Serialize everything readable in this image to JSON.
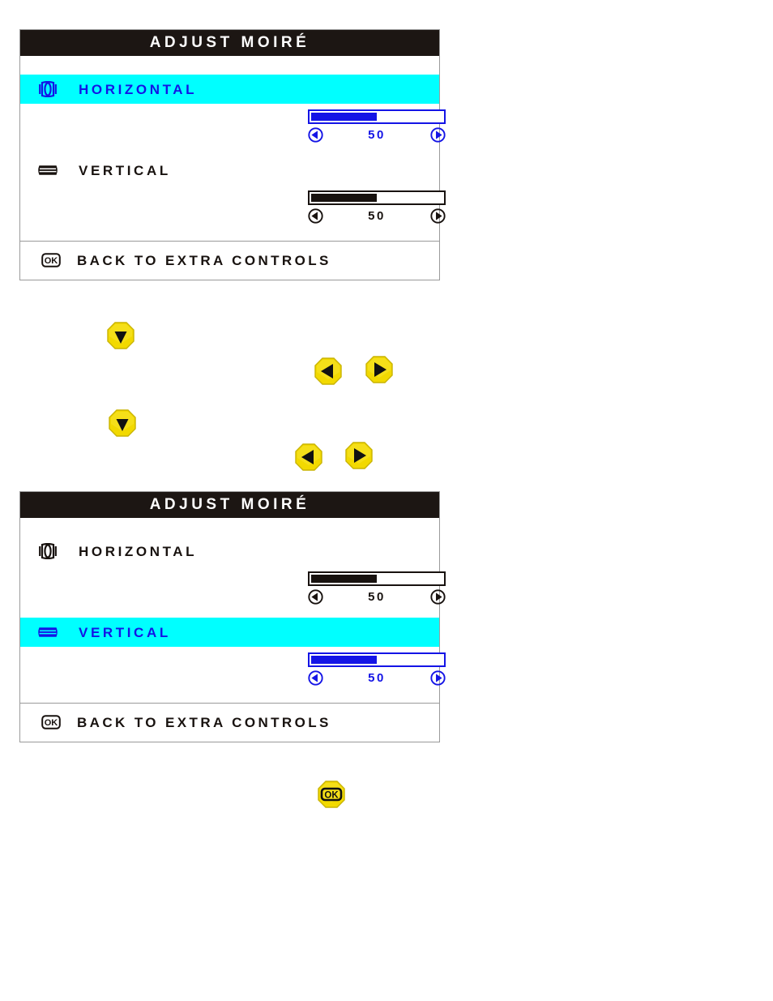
{
  "panels": [
    {
      "title": "ADJUST MOIRÉ",
      "items": [
        {
          "label": "HORIZONTAL",
          "icon": "moire-horizontal-icon",
          "active": true,
          "value": "50",
          "fill_percent": 50,
          "left_arrow": "decrease-arrow-icon",
          "right_arrow": "increase-arrow-icon"
        },
        {
          "label": "VERTICAL",
          "icon": "moire-vertical-icon",
          "active": false,
          "value": "50",
          "fill_percent": 50,
          "left_arrow": "decrease-arrow-icon",
          "right_arrow": "increase-arrow-icon"
        }
      ],
      "back": {
        "label": "BACK TO EXTRA CONTROLS",
        "icon": "ok-button-icon"
      }
    },
    {
      "title": "ADJUST MOIRÉ",
      "items": [
        {
          "label": "HORIZONTAL",
          "icon": "moire-horizontal-icon",
          "active": false,
          "value": "50",
          "fill_percent": 50,
          "left_arrow": "decrease-arrow-icon",
          "right_arrow": "increase-arrow-icon"
        },
        {
          "label": "VERTICAL",
          "icon": "moire-vertical-icon",
          "active": true,
          "value": "50",
          "fill_percent": 50,
          "left_arrow": "decrease-arrow-icon",
          "right_arrow": "increase-arrow-icon"
        }
      ],
      "back": {
        "label": "BACK TO EXTRA CONTROLS",
        "icon": "ok-button-icon"
      }
    }
  ],
  "hardware_buttons": [
    {
      "id": "btn-down-1",
      "name": "down-hardware-button",
      "glyph": "down-triangle-icon"
    },
    {
      "id": "btn-left-1",
      "name": "left-hardware-button",
      "glyph": "left-triangle-icon"
    },
    {
      "id": "btn-right-1",
      "name": "right-hardware-button",
      "glyph": "right-triangle-icon"
    },
    {
      "id": "btn-down-2",
      "name": "down-hardware-button",
      "glyph": "down-triangle-icon"
    },
    {
      "id": "btn-left-2",
      "name": "left-hardware-button",
      "glyph": "left-triangle-icon"
    },
    {
      "id": "btn-right-2",
      "name": "right-hardware-button",
      "glyph": "right-triangle-icon"
    },
    {
      "id": "btn-ok",
      "name": "ok-hardware-button",
      "glyph": "ok-glyph-icon"
    }
  ],
  "colors": {
    "highlight": "#00ffff",
    "active_text": "#1414e6",
    "inactive_text": "#18120f",
    "title_bar": "#1c1613",
    "panel_border": "#9a9a9a",
    "hardware_button": "#f2d900"
  }
}
